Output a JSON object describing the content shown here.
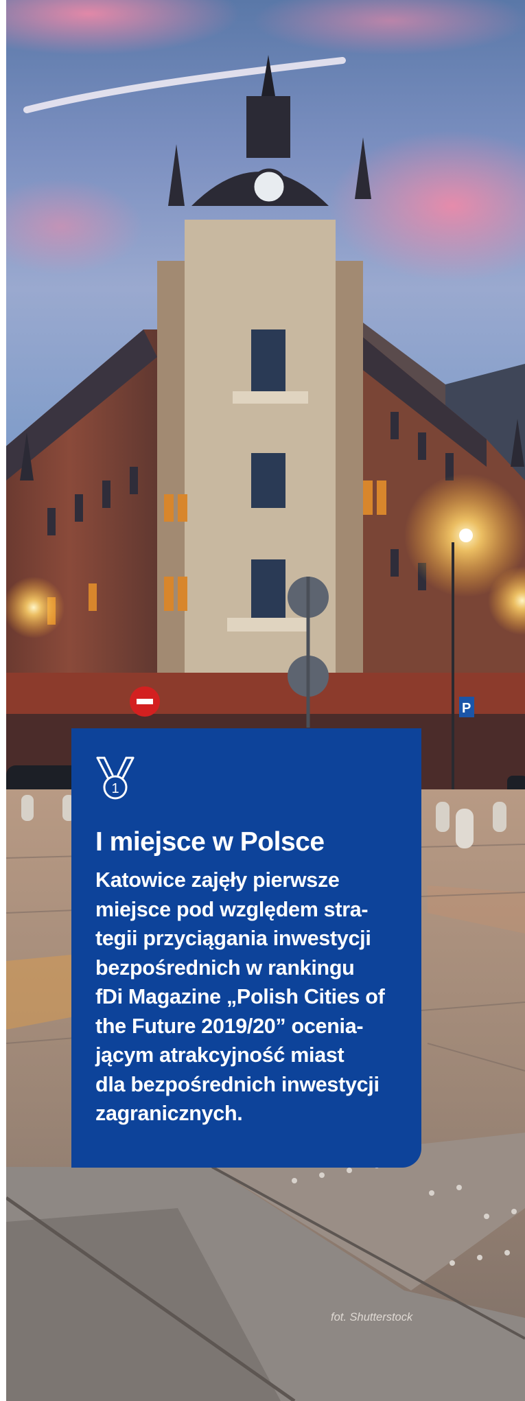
{
  "card": {
    "heading": "I miejsce w Polsce",
    "body_lines": [
      "Katowice zajęły pierwsze",
      "miejsce pod względem stra-",
      "tegii przyciągania inwestycji",
      "bezpośrednich w rankingu",
      "fDi Magazine „Polish Cities of",
      "the Future 2019/20” ocenia-",
      "jącym atrakcyjność miast",
      "dla bezpośrednich inwestycji",
      "zagranicznych."
    ],
    "medal_number": "1",
    "medal_icon": "medal-icon",
    "background_color": "#0d439a"
  },
  "photo": {
    "icon": "city-building-photo",
    "parking_sign": "P"
  },
  "photo_credit": "fot. Shutterstock"
}
